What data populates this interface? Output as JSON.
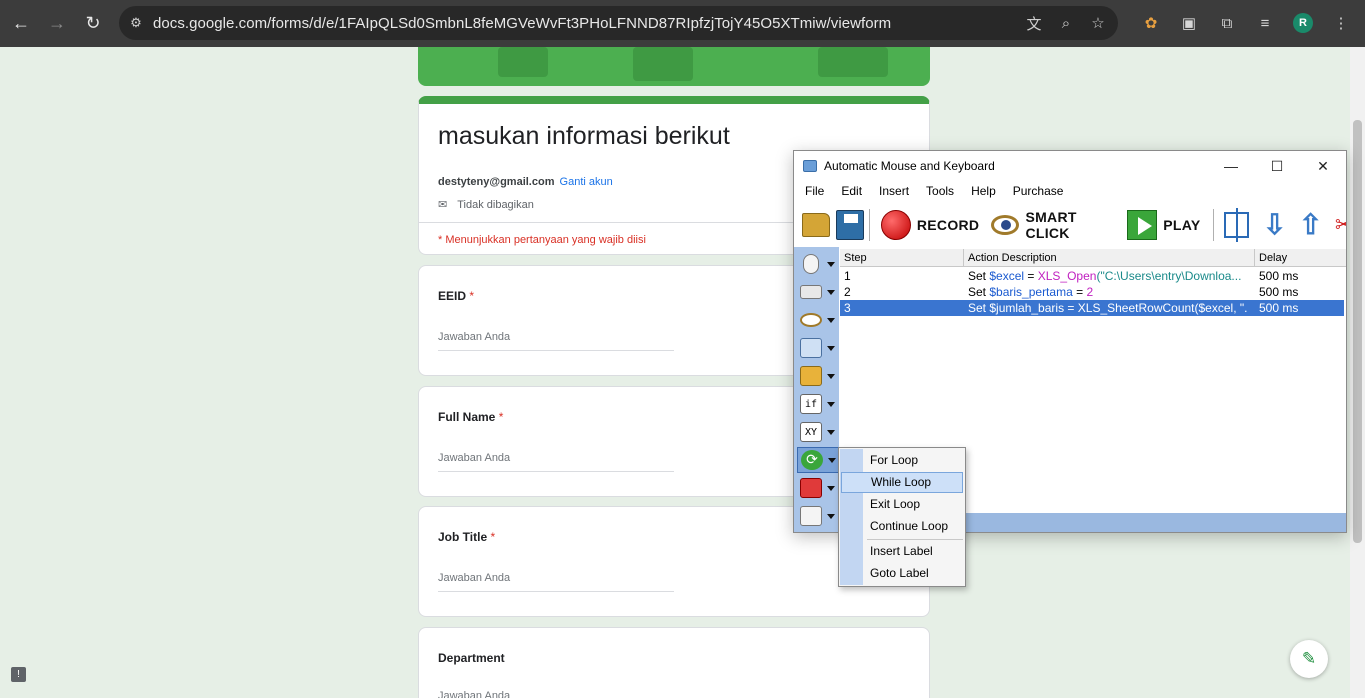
{
  "browser": {
    "url": "docs.google.com/forms/d/e/1FAIpQLSd0SmbnL8feMGVeWvFt3PHoLFNND87RIpfzjTojY45O5XTmiw/viewform",
    "profile_initial": "R"
  },
  "form": {
    "title": "masukan informasi berikut",
    "email": "destyteny@gmail.com",
    "switch_account": "Ganti akun",
    "not_shared": "Tidak dibagikan",
    "required_note": "* Menunjukkan pertanyaan yang wajib diisi",
    "required_marker": "*",
    "questions": [
      {
        "label": "EEID",
        "placeholder": "Jawaban Anda"
      },
      {
        "label": "Full Name",
        "placeholder": "Jawaban Anda"
      },
      {
        "label": "Job Title",
        "placeholder": "Jawaban Anda"
      },
      {
        "label": "Department",
        "placeholder": "Jawaban Anda"
      }
    ]
  },
  "app": {
    "title": "Automatic Mouse and Keyboard",
    "menu": [
      "File",
      "Edit",
      "Insert",
      "Tools",
      "Help",
      "Purchase"
    ],
    "toolbar": {
      "record": "RECORD",
      "smart_click": "SMART CLICK",
      "play": "PLAY"
    },
    "side_labels": {
      "if": "if",
      "xy": "XY"
    },
    "columns": [
      "Step",
      "Action Description",
      "Delay"
    ],
    "rows": [
      {
        "step": "1",
        "set": "Set",
        "var": "$excel",
        "op": " = ",
        "fn": "XLS_Open",
        "arg": "(\"C:\\Users\\entry\\Downloa...",
        "delay": "500 ms"
      },
      {
        "step": "2",
        "set": "Set",
        "var": "$baris_pertama",
        "op": " = ",
        "fn": "",
        "arg": "2",
        "delay": "500 ms"
      },
      {
        "step": "3",
        "set": "Set",
        "var": "$jumlah_baris",
        "op": " = ",
        "fn": "XLS_SheetRowCount",
        "arg": "($excel, \".",
        "delay": "500 ms"
      }
    ],
    "context_menu": [
      "For Loop",
      "While Loop",
      "Exit Loop",
      "Continue Loop",
      "Insert Label",
      "Goto Label"
    ]
  }
}
